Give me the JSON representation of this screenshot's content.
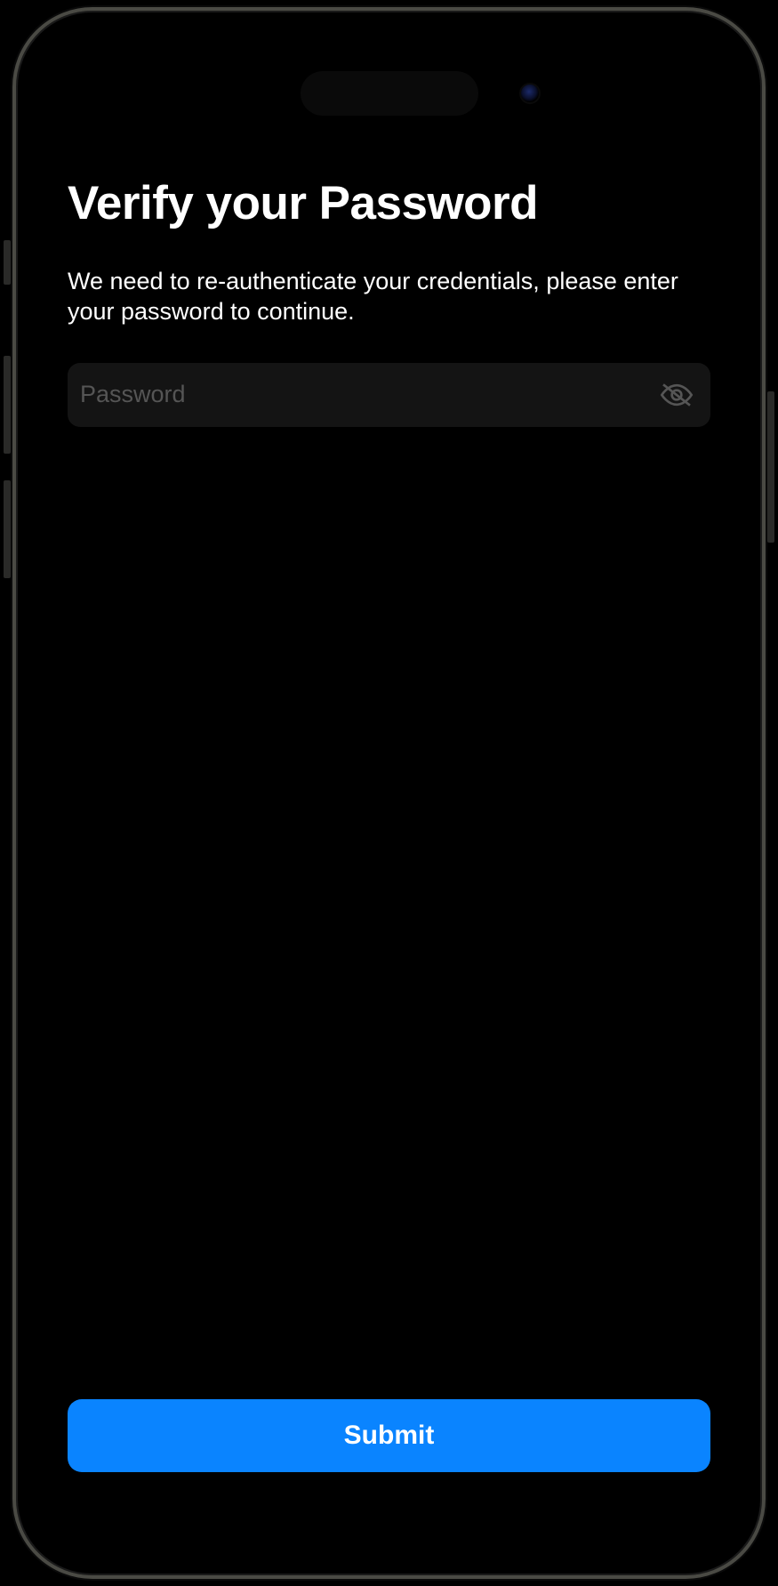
{
  "header": {
    "title": "Verify your Password",
    "description": "We need to re-authenticate your credentials, please enter your password to continue."
  },
  "form": {
    "password_placeholder": "Password",
    "password_value": "",
    "visibility_icon": "eye-off-icon"
  },
  "actions": {
    "submit_label": "Submit"
  }
}
